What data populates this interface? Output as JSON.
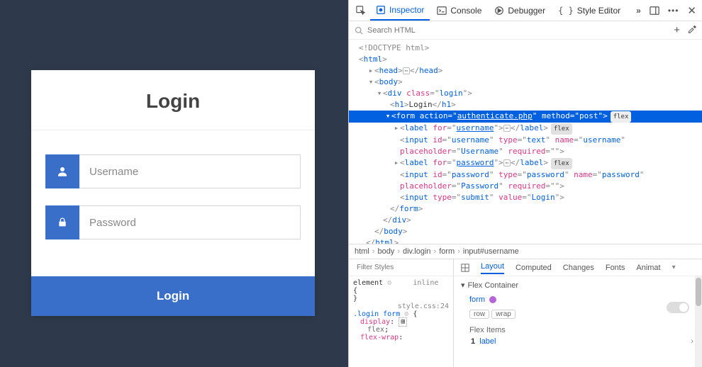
{
  "login": {
    "heading": "Login",
    "usernamePlaceholder": "Username",
    "passwordPlaceholder": "Password",
    "submitLabel": "Login"
  },
  "devtools": {
    "tabs": {
      "inspector": "Inspector",
      "console": "Console",
      "debugger": "Debugger",
      "styleEditor": "Style Editor"
    },
    "searchPlaceholder": "Search HTML",
    "tree": {
      "doctype": "<!DOCTYPE html>",
      "htmlOpen": "html",
      "headOpen": "head",
      "headClose": "head",
      "bodyOpen": "body",
      "divLogin": {
        "tag": "div",
        "attrClass": "class",
        "classVal": "login"
      },
      "h1": {
        "tag": "h1",
        "text": "Login"
      },
      "form": {
        "tag": "form",
        "action": "authenticate.php",
        "method": "post",
        "flex": "flex"
      },
      "label1": {
        "tag": "label",
        "forAttr": "for",
        "forVal": "username",
        "flex": "flex"
      },
      "input1": {
        "tag": "input",
        "id": "username",
        "type": "text",
        "name": "username",
        "placeholder": "Username",
        "required": ""
      },
      "label2": {
        "tag": "label",
        "forAttr": "for",
        "forVal": "password",
        "flex": "flex"
      },
      "input2": {
        "tag": "input",
        "id": "password",
        "type": "password",
        "name": "password",
        "placeholder": "Password",
        "required": ""
      },
      "input3": {
        "tag": "input",
        "type": "submit",
        "value": "Login"
      }
    },
    "crumbs": [
      "html",
      "body",
      "div.login",
      "form",
      "input#username"
    ],
    "rules": {
      "filterPlaceholder": "Filter Styles",
      "element": "element",
      "inline": "inline",
      "brace1": "{",
      "brace2": "}",
      "source": "style.css:24",
      "selector": ".login form",
      "prop1": "display",
      "val1": "flex",
      "prop2": "flex-wrap"
    },
    "layout": {
      "tabs": {
        "layout": "Layout",
        "computed": "Computed",
        "changes": "Changes",
        "fonts": "Fonts",
        "animat": "Animat"
      },
      "flexContainer": "Flex Container",
      "form": "form",
      "row": "row",
      "wrap": "wrap",
      "flexItems": "Flex Items",
      "item1num": "1",
      "item1": "label"
    }
  }
}
